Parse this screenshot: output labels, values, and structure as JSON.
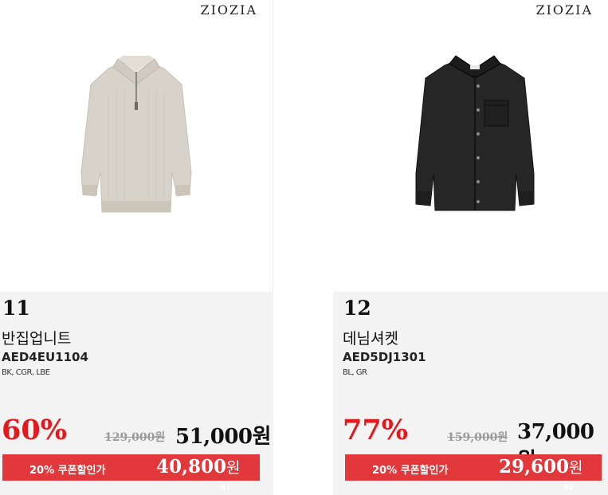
{
  "products": [
    {
      "brand": "ZIOZIA",
      "number": "11",
      "name": "반집업니트",
      "code": "AED4EU1104",
      "colors": "BK, CGR, LBE",
      "discount": "60%",
      "original_price": "129,000원",
      "sale_price": "51,000원",
      "coupon_label": "20% 쿠폰할인가",
      "coupon_price": "40,800",
      "coupon_unit": "원",
      "image_icon": "half-zip-knit-sweater-beige",
      "peek_text": "91"
    },
    {
      "brand": "ZIOZIA",
      "number": "12",
      "name": "데님셔켓",
      "code": "AED5DJ1301",
      "colors": "BL, GR",
      "discount": "77%",
      "original_price": "159,000원",
      "sale_price": "37,000원",
      "coupon_label": "20% 쿠폰할인가",
      "coupon_price": "29,600",
      "coupon_unit": "원",
      "image_icon": "denim-shirt-jacket-black",
      "peek_text": "91"
    }
  ],
  "colors": {
    "accent_red": "#e01a1e",
    "coupon_bg": "#e2373b",
    "info_bg": "#f3f3f3"
  }
}
